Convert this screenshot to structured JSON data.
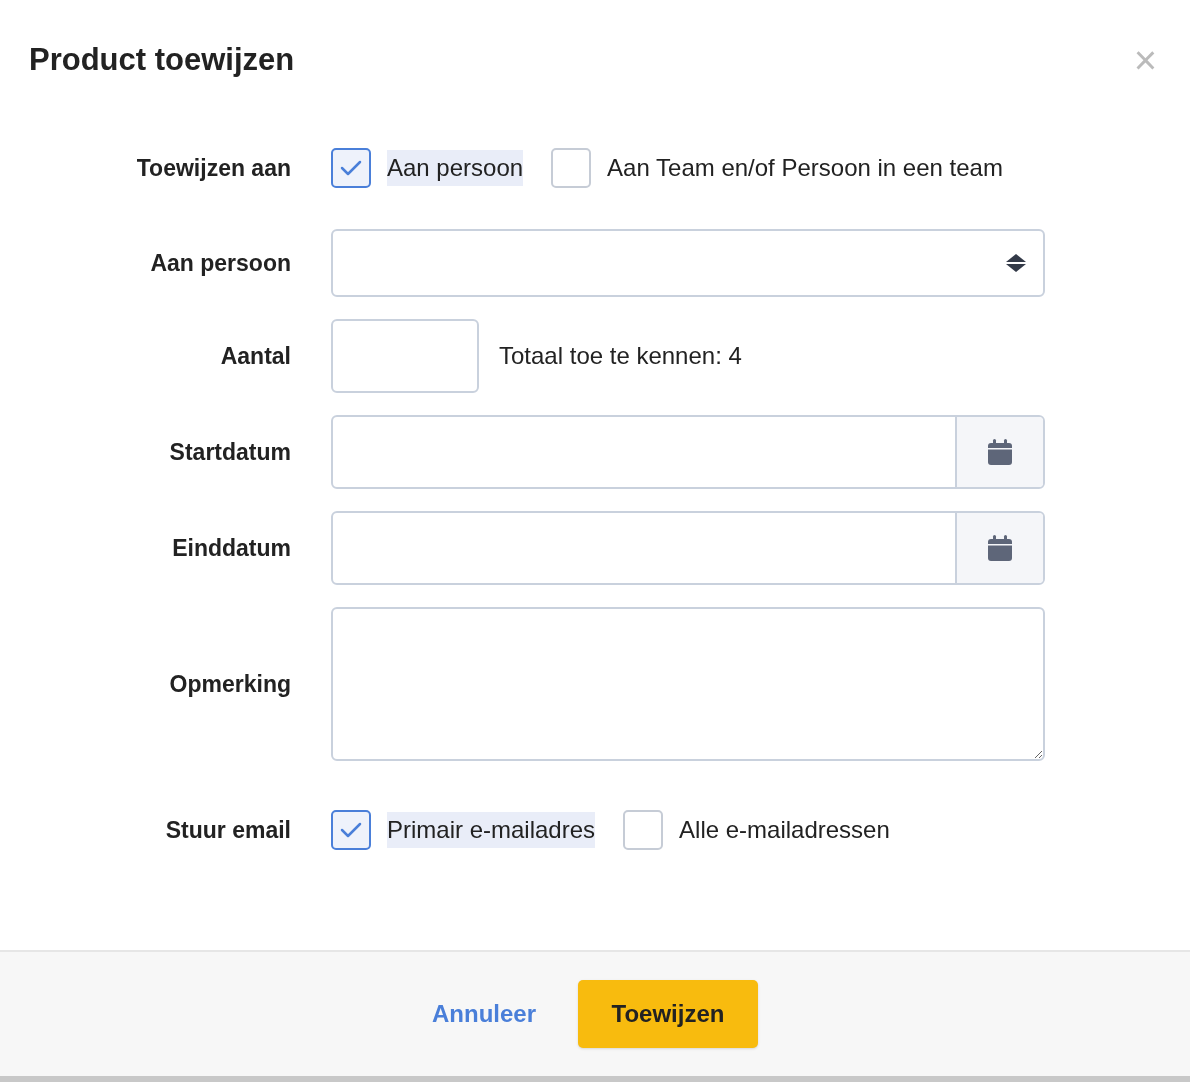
{
  "dialog": {
    "title": "Product toewijzen",
    "close": "×"
  },
  "fields": [
    {
      "kind": "checkboxes",
      "label": "Toewijzen aan",
      "options": [
        {
          "label": "Aan persoon",
          "checked": true
        },
        {
          "label": "Aan Team en/of Persoon in een team",
          "checked": false
        }
      ]
    },
    {
      "kind": "select",
      "label": "Aan persoon"
    },
    {
      "kind": "number",
      "label": "Aantal",
      "note": "Totaal toe te kennen: 4"
    },
    {
      "kind": "date",
      "label": "Startdatum"
    },
    {
      "kind": "date",
      "label": "Einddatum"
    },
    {
      "kind": "textarea",
      "label": "Opmerking"
    },
    {
      "kind": "checkboxes",
      "label": "Stuur email",
      "options": [
        {
          "label": "Primair e-mailadres",
          "checked": true
        },
        {
          "label": "Alle e-mailadressen",
          "checked": false
        }
      ]
    }
  ],
  "footer": {
    "cancel": "Annuleer",
    "submit": "Toewijzen"
  }
}
